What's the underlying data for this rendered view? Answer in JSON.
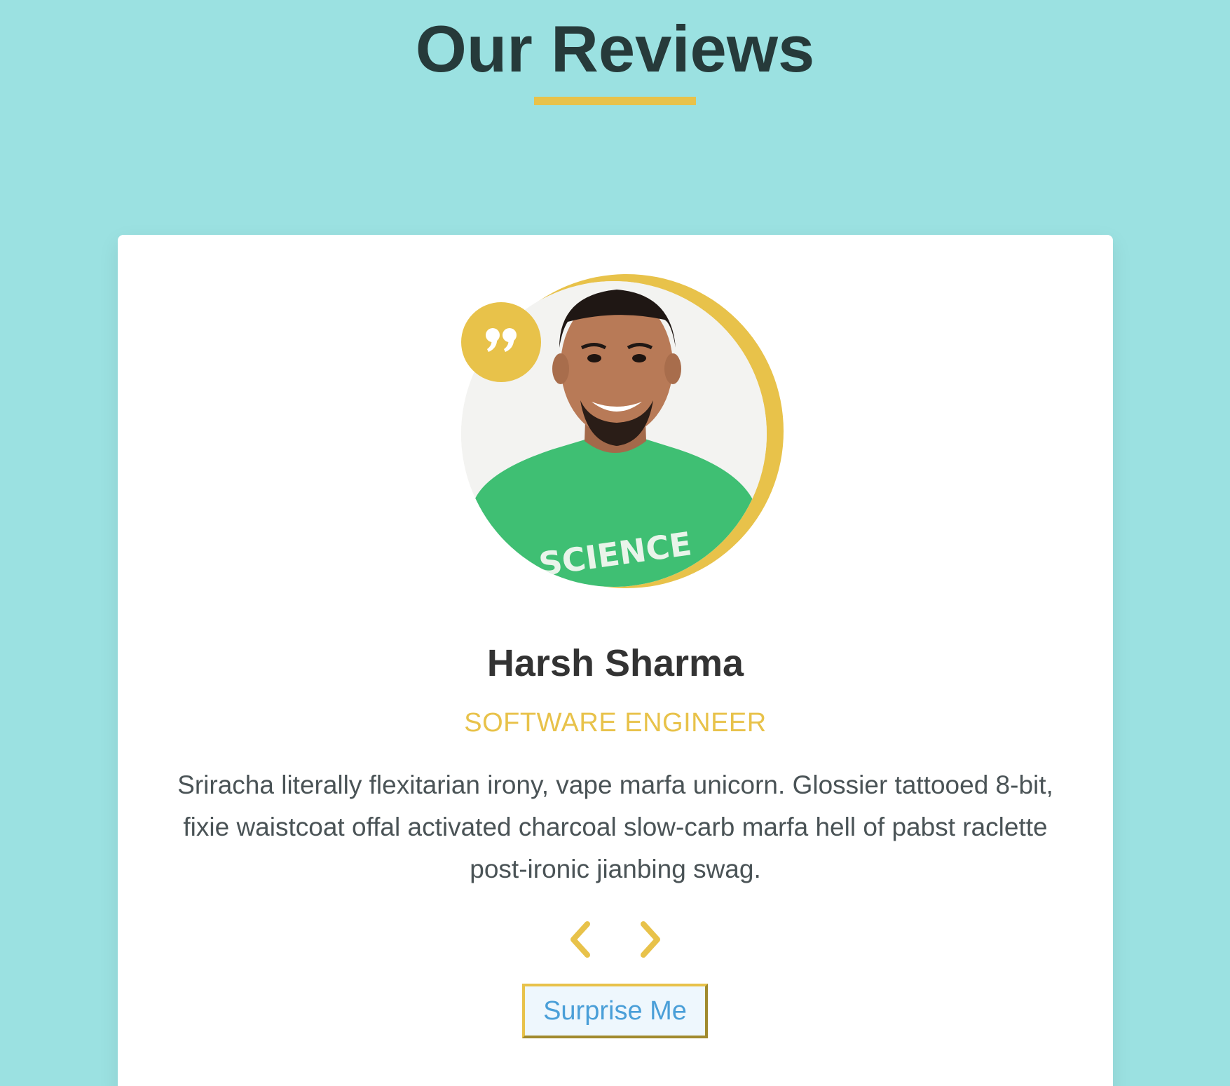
{
  "header": {
    "title": "Our Reviews"
  },
  "review": {
    "name": "Harsh Sharma",
    "job": "SOFTWARE ENGINEER",
    "text": "Sriracha literally flexitarian irony, vape marfa unicorn. Glossier tattooed 8-bit, fixie waistcoat offal activated charcoal slow-carb marfa hell of pabst raclette post-ironic jianbing swag.",
    "shirt_text": "SCIENCE"
  },
  "buttons": {
    "random_label": "Surprise Me"
  },
  "icons": {
    "quote": "quote-icon",
    "prev": "chevron-left-icon",
    "next": "chevron-right-icon"
  },
  "colors": {
    "background": "#9be1e1",
    "accent": "#e8c24a",
    "title": "#263a3a",
    "name": "#333333",
    "text": "#4a5356",
    "button_text": "#4a9fd8"
  }
}
